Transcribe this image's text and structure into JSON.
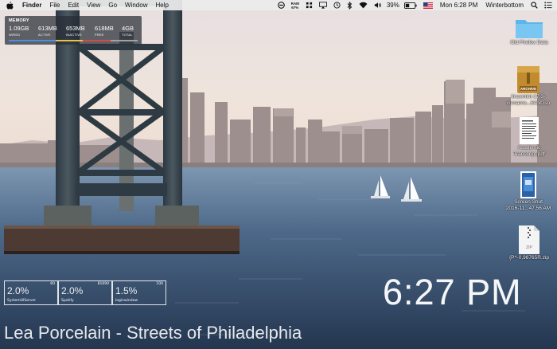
{
  "menubar": {
    "app_name": "Finder",
    "menus": [
      "File",
      "Edit",
      "View",
      "Go",
      "Window",
      "Help"
    ],
    "status": {
      "memory_pct_top": "RAM",
      "memory_pct_bottom": "67%",
      "battery_pct": "39%",
      "datetime": "Mon 6:28 PM",
      "user": "Winterbottom"
    }
  },
  "memory_widget": {
    "title": "MEMORY",
    "stats": [
      {
        "value": "1.09GB",
        "label": "WIRED",
        "color": "#4a90e2"
      },
      {
        "value": "613MB",
        "label": "ACTIVE",
        "color": "#e8c34a"
      },
      {
        "value": "653MB",
        "label": "INACTIVE",
        "color": "#d24b4b"
      },
      {
        "value": "618MB",
        "label": "FREE",
        "color": "#9fa3a8"
      },
      {
        "value": "4GB",
        "label": "TOTAL",
        "color": "#9fa3a8"
      }
    ]
  },
  "cpu_widget": [
    {
      "percent": "2.0%",
      "pid": "60",
      "process": "SystemUIServer"
    },
    {
      "percent": "2.0%",
      "pid": "81690",
      "process": "Spotify"
    },
    {
      "percent": "1.5%",
      "pid": "100",
      "process": "loginwindow"
    }
  ],
  "clock": "6:27 PM",
  "now_playing": "Lea Porcelain  - Streets of Philadelphia",
  "desktop_icons": [
    {
      "line1": "Old Firefox Data",
      "line2": ""
    },
    {
      "line1": "linuxmint-17.3-",
      "line2": "cinnamo...64bit.iso",
      "badge": "ARCHIVE"
    },
    {
      "line1": "Academic",
      "line2": "Transcript.pdf"
    },
    {
      "line1": "Screen Shot",
      "line2": "2016-11...47.56 AM"
    },
    {
      "line1": "{P^-0,98765R.zip",
      "line2": "",
      "badge": "ZIP"
    }
  ]
}
